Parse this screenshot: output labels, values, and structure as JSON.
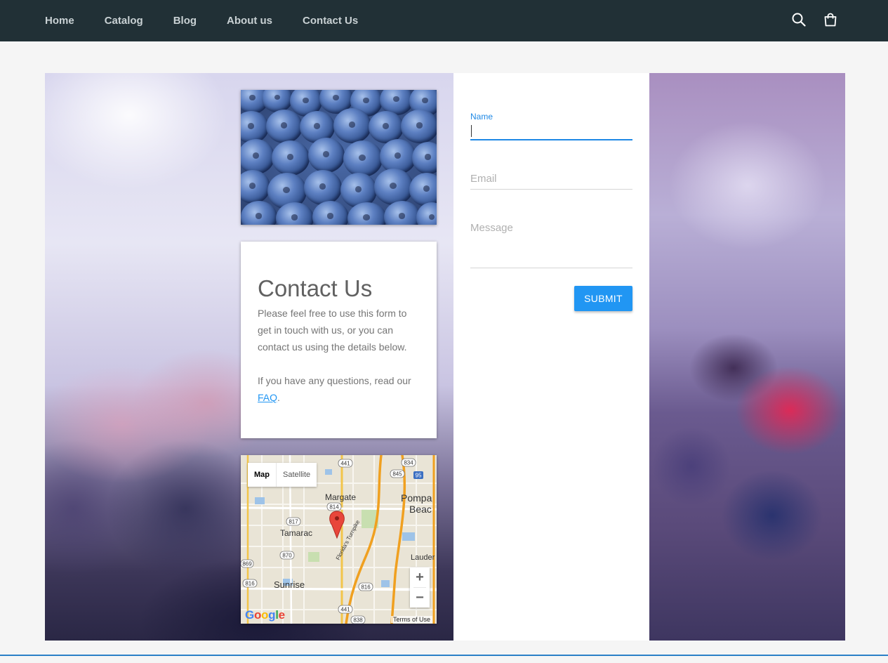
{
  "nav": {
    "links": [
      "Home",
      "Catalog",
      "Blog",
      "About us",
      "Contact Us"
    ],
    "icons": [
      "search-icon",
      "cart-icon"
    ],
    "background": "#213036"
  },
  "contact": {
    "title": "Contact Us",
    "paragraph1": "Please feel free to use this form to get in touch with us, or you can contact us using the details below.",
    "paragraph2_prefix": "If you have any questions, read our ",
    "faq_link": "FAQ",
    "paragraph2_suffix": "."
  },
  "form": {
    "name_label": "Name",
    "email_placeholder": "Email",
    "message_placeholder": "Message",
    "submit_label": "SUBMIT",
    "accent": "#2196f3"
  },
  "map": {
    "map_tab": "Map",
    "satellite_tab": "Satellite",
    "places": [
      "Margate",
      "Tamarac",
      "Sunrise",
      "Pompa",
      "Beac",
      "Lauder"
    ],
    "road_labels": [
      "441",
      "834",
      "845",
      "95",
      "814",
      "817",
      "870",
      "869",
      "816",
      "816",
      "441",
      "838"
    ],
    "turnpike": "Florida's Turnpike",
    "zoom_in": "+",
    "zoom_out": "−",
    "google": "Google",
    "terms": "Terms of Use"
  }
}
